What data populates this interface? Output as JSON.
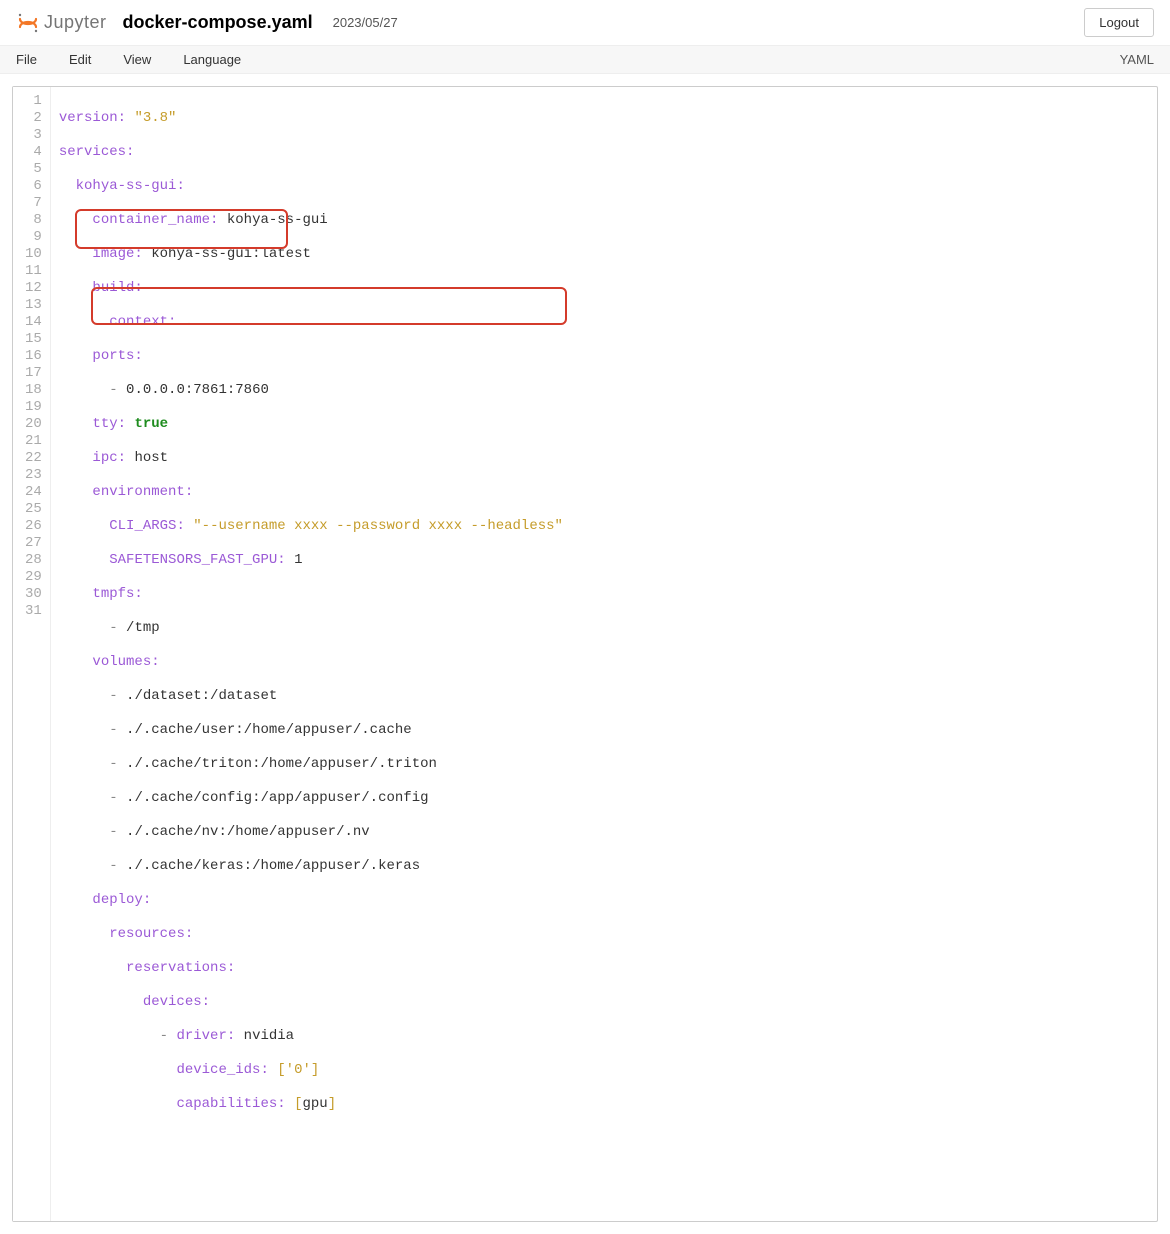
{
  "header": {
    "app_name": "Jupyter",
    "filename": "docker-compose.yaml",
    "timestamp": "2023/05/27",
    "logout_label": "Logout"
  },
  "menu": {
    "file": "File",
    "edit": "Edit",
    "view": "View",
    "language": "Language",
    "lang_indicator": "YAML"
  },
  "code": {
    "line1_key": "version:",
    "line1_val": "\"3.8\"",
    "line2_key": "services:",
    "line3_key": "kohya-ss-gui:",
    "line4_key": "container_name:",
    "line4_val": "kohya-ss-gui",
    "line5_key": "image:",
    "line5_val": "kohya-ss-gui:latest",
    "line6_key": "build:",
    "line7_key": "context:",
    "line7_val": ".",
    "line8_key": "ports:",
    "line9_dash": "-",
    "line9_val": "0.0.0.0:7861:7860",
    "line10_key": "tty:",
    "line10_val": "true",
    "line11_key": "ipc:",
    "line11_val": "host",
    "line12_key": "environment:",
    "line13_key": "CLI_ARGS:",
    "line13_val": "\"--username xxxx --password xxxx --headless\"",
    "line14_key": "SAFETENSORS_FAST_GPU:",
    "line14_val": "1",
    "line15_key": "tmpfs:",
    "line16_dash": "-",
    "line16_val": "/tmp",
    "line17_key": "volumes:",
    "line18_dash": "-",
    "line18_val": "./dataset:/dataset",
    "line19_dash": "-",
    "line19_val": "./.cache/user:/home/appuser/.cache",
    "line20_dash": "-",
    "line20_val": "./.cache/triton:/home/appuser/.triton",
    "line21_dash": "-",
    "line21_val": "./.cache/config:/app/appuser/.config",
    "line22_dash": "-",
    "line22_val": "./.cache/nv:/home/appuser/.nv",
    "line23_dash": "-",
    "line23_val": "./.cache/keras:/home/appuser/.keras",
    "line24_key": "deploy:",
    "line25_key": "resources:",
    "line26_key": "reservations:",
    "line27_key": "devices:",
    "line28_dash": "-",
    "line28_key": "driver:",
    "line28_val": "nvidia",
    "line29_key": "device_ids:",
    "line29_val_open": "[",
    "line29_val_item": "'0'",
    "line29_val_close": "]",
    "line30_key": "capabilities:",
    "line30_val_open": "[",
    "line30_val_item": "gpu",
    "line30_val_close": "]"
  }
}
